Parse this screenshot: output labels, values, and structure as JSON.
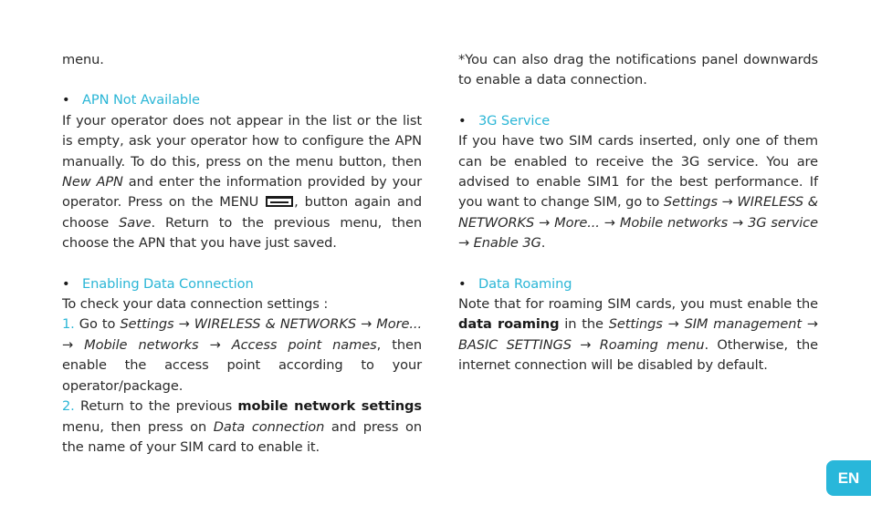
{
  "left_column": {
    "intro_tail": "menu.",
    "apn_section": {
      "bullet": "•",
      "heading": "APN Not Available",
      "p1": "If your operator does not appear in the list or the list is empty, ask your operator how to configure the APN manually. To do this, press on the menu button, then ",
      "new_apn": "New APN",
      "p2": " and enter the information provided by your operator. Press on the MENU ",
      "menu_icon": "menu-button-icon",
      "p3": ", button again and choose ",
      "save": "Save",
      "p4": ". Return to the previous menu, then choose the APN that you have just saved."
    },
    "data_connection_section": {
      "bullet": "•",
      "heading": "Enabling Data Connection",
      "intro": "To check your data connection settings :",
      "step1": {
        "num": "1.",
        "text_a": " Go to ",
        "path": [
          "Settings",
          "WIRELESS & NETWORKS",
          "More...",
          "Mobile networks",
          "Access point names"
        ],
        "arrow": "→",
        "text_b": ", then enable the access point according to your operator/package."
      },
      "step2": {
        "num": "2.",
        "text_a": " Return to the previous ",
        "bold": "mobile network settings",
        "text_b": " menu, then press on ",
        "italic": "Data connection",
        "text_c": " and press on the name of your SIM card to enable it."
      }
    }
  },
  "right_column": {
    "note": "*You can also drag the notifications panel downwards to enable a data connection.",
    "service_3g": {
      "bullet": "•",
      "heading": "3G Service",
      "text_a": "If you have two SIM cards inserted, only one of them can be enabled to receive the 3G service. You are advised to enable SIM1 for the best performance. If you want to change SIM, go to ",
      "path": [
        "Settings",
        "WIRELESS & NETWORKS",
        "More...",
        "Mobile networks",
        "3G service",
        "Enable 3G"
      ],
      "arrow": "→",
      "text_b": "."
    },
    "roaming": {
      "bullet": "•",
      "heading": "Data Roaming",
      "text_a": "Note that for roaming SIM cards, you must enable the ",
      "bold": "data roaming",
      "text_b": " in the ",
      "path": [
        "Settings",
        "SIM management",
        "BASIC SETTINGS",
        "Roaming menu"
      ],
      "arrow": "→",
      "text_c": ". Otherwise, the internet connection will be disabled by default."
    }
  },
  "language_badge": {
    "label": "EN",
    "color": "#29b7da"
  },
  "accent_color": "#2bb6d6"
}
